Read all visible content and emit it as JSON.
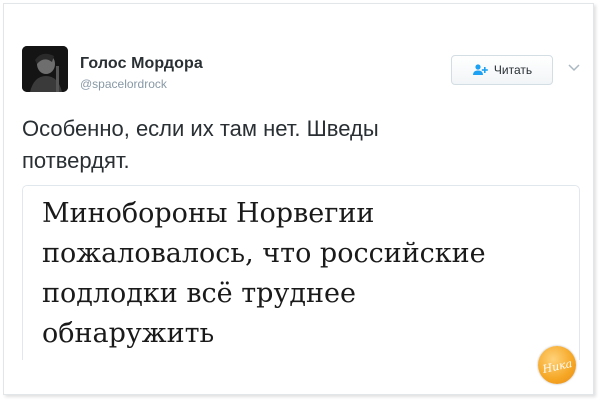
{
  "author": {
    "name": "Голос Мордора",
    "handle": "@spacelordrock"
  },
  "follow_button": {
    "label": "Читать",
    "icon": "add-user-icon"
  },
  "tweet": {
    "text_lines": [
      "Особенно, если их там нет. Шведы",
      "потвердят."
    ]
  },
  "card": {
    "headline_lines": [
      "Минобороны Норвегии",
      "пожаловалось, что российские",
      "подлодки всё труднее",
      "обнаружить"
    ]
  },
  "watermark": {
    "text": "Ника"
  },
  "colors": {
    "name": "#292f33",
    "handle": "#8899a6",
    "icon_accent": "#1da1f2",
    "watermark": "#f5a623"
  }
}
